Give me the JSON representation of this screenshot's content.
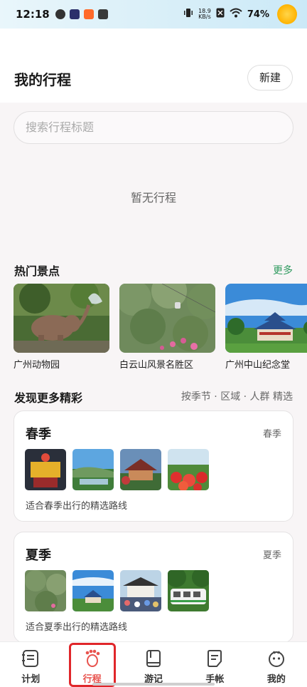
{
  "status_bar": {
    "time": "12:18",
    "net_speed_value": "18.9",
    "net_speed_unit": "KB/s",
    "battery": "74%"
  },
  "header": {
    "title": "我的行程",
    "new_label": "新建"
  },
  "search": {
    "placeholder": "搜索行程标题"
  },
  "empty_state": "暂无行程",
  "hot_spots": {
    "title": "热门景点",
    "more": "更多",
    "items": [
      {
        "label": "广州动物园"
      },
      {
        "label": "白云山风景名胜区"
      },
      {
        "label": "广州中山纪念堂"
      }
    ]
  },
  "discover": {
    "title": "发现更多精彩",
    "filters": "按季节 · 区域 · 人群 精选",
    "seasons": [
      {
        "name": "春季",
        "tag": "春季",
        "desc": "适合春季出行的精选路线"
      },
      {
        "name": "夏季",
        "tag": "夏季",
        "desc": "适合夏季出行的精选路线"
      }
    ]
  },
  "bottom_nav": {
    "items": [
      {
        "label": "计划",
        "icon": "plan-icon"
      },
      {
        "label": "行程",
        "icon": "footprint-icon"
      },
      {
        "label": "游记",
        "icon": "book-icon"
      },
      {
        "label": "手帐",
        "icon": "note-icon"
      },
      {
        "label": "我的",
        "icon": "profile-icon"
      }
    ],
    "active_index": 1
  },
  "colors": {
    "accent_green": "#2f9a5f",
    "active_red": "#e8534e",
    "highlight_border": "#e0262a"
  }
}
